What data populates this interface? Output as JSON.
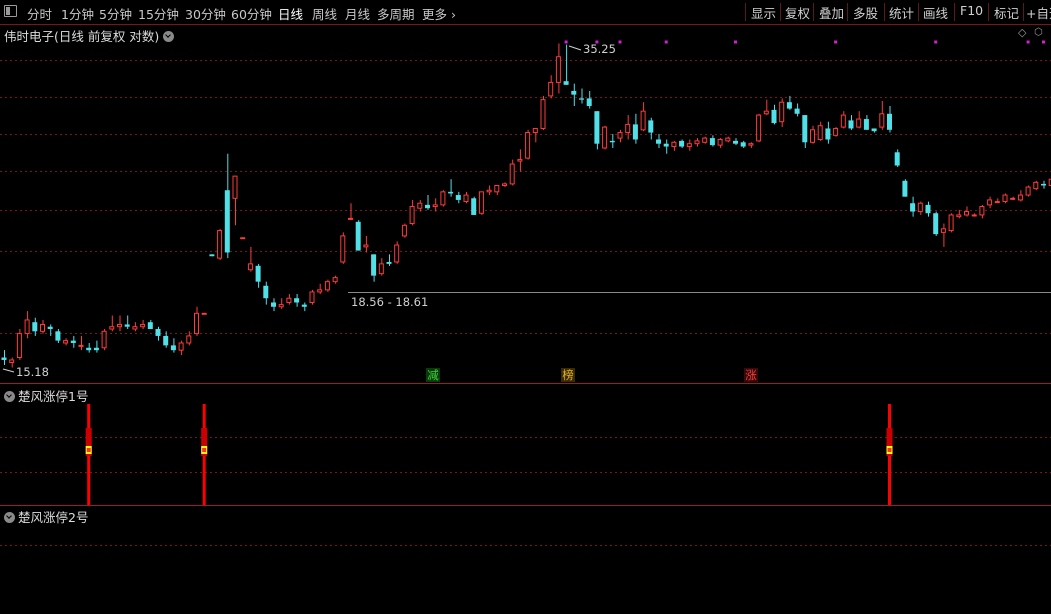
{
  "toolbar": {
    "periods": [
      "分时",
      "1分钟",
      "5分钟",
      "15分钟",
      "30分钟",
      "60分钟",
      "日线",
      "周线",
      "月线",
      "多周期",
      "更多"
    ],
    "selected_period": "日线",
    "right_tools": [
      "显示",
      "复权",
      "叠加",
      "多股",
      "统计",
      "画线",
      "F10",
      "标记",
      "+自选"
    ]
  },
  "main_chart": {
    "title": "伟时电子(日线 前复权 对数)",
    "high_label": "35.25",
    "low_label": "15.18",
    "range_label": "18.56 - 18.61",
    "event_tags": [
      {
        "text": "减",
        "color": "#20c020"
      },
      {
        "text": "榜",
        "color": "#d0a020"
      },
      {
        "text": "涨",
        "color": "#e03030"
      }
    ]
  },
  "indicator_panels": [
    {
      "title": "楚风涨停1号"
    },
    {
      "title": "楚风涨停2号"
    }
  ],
  "colors": {
    "up": "#ff3b3b",
    "down": "#4fe0e8",
    "grid": "#7a1818",
    "border": "#9a2020",
    "signal": "#ff0000",
    "marker": "#d020d0"
  },
  "chart_data": {
    "type": "candlestick",
    "scale": "log",
    "grid": true,
    "candles": [
      [
        15.6,
        15.9,
        15.3,
        15.5
      ],
      [
        15.4,
        15.6,
        15.2,
        15.5
      ],
      [
        15.6,
        16.8,
        15.5,
        16.6
      ],
      [
        16.6,
        17.6,
        16.4,
        17.2
      ],
      [
        17.1,
        17.3,
        16.5,
        16.7
      ],
      [
        16.7,
        17.2,
        16.6,
        17.0
      ],
      [
        16.9,
        17.0,
        16.5,
        16.8
      ],
      [
        16.7,
        16.8,
        16.2,
        16.3
      ],
      [
        16.2,
        16.4,
        16.1,
        16.3
      ],
      [
        16.3,
        16.5,
        16.0,
        16.2
      ],
      [
        16.1,
        16.5,
        15.9,
        16.1
      ],
      [
        16.0,
        16.2,
        15.8,
        15.9
      ],
      [
        16.0,
        16.3,
        15.8,
        15.9
      ],
      [
        16.0,
        16.8,
        15.9,
        16.7
      ],
      [
        16.8,
        17.4,
        16.7,
        16.9
      ],
      [
        16.9,
        17.4,
        16.7,
        17.0
      ],
      [
        17.0,
        17.4,
        16.8,
        16.9
      ],
      [
        16.8,
        17.1,
        16.7,
        16.9
      ],
      [
        16.9,
        17.2,
        16.8,
        17.0
      ],
      [
        17.1,
        17.2,
        16.8,
        16.8
      ],
      [
        16.8,
        16.9,
        16.3,
        16.5
      ],
      [
        16.5,
        16.7,
        16.0,
        16.1
      ],
      [
        16.1,
        16.4,
        15.8,
        15.9
      ],
      [
        15.9,
        16.3,
        15.7,
        16.2
      ],
      [
        16.2,
        16.7,
        16.1,
        16.5
      ],
      [
        16.6,
        17.8,
        16.5,
        17.5
      ],
      [
        17.5,
        17.5,
        17.5,
        17.5
      ],
      [
        20.4,
        20.4,
        20.3,
        20.3
      ],
      [
        20.2,
        21.8,
        20.1,
        21.7
      ],
      [
        24.1,
        26.5,
        20.2,
        20.5
      ],
      [
        23.6,
        25.0,
        22.0,
        25.0
      ],
      [
        21.3,
        21.3,
        21.3,
        21.3
      ],
      [
        19.6,
        20.8,
        19.5,
        19.9
      ],
      [
        19.8,
        19.9,
        18.7,
        19.0
      ],
      [
        18.8,
        19.0,
        17.9,
        18.2
      ],
      [
        18.0,
        18.2,
        17.6,
        17.8
      ],
      [
        17.8,
        18.2,
        17.7,
        17.9
      ],
      [
        18.0,
        18.4,
        17.9,
        18.2
      ],
      [
        18.2,
        18.4,
        17.8,
        18.0
      ],
      [
        17.9,
        18.0,
        17.6,
        17.8
      ],
      [
        18.0,
        18.6,
        17.9,
        18.5
      ],
      [
        18.5,
        18.9,
        18.4,
        18.6
      ],
      [
        18.6,
        19.1,
        18.5,
        19.0
      ],
      [
        19.0,
        19.3,
        18.9,
        19.2
      ],
      [
        20.0,
        21.6,
        19.9,
        21.4
      ],
      [
        22.4,
        23.3,
        22.3,
        22.4
      ],
      [
        22.2,
        22.3,
        20.6,
        20.6
      ],
      [
        20.8,
        21.4,
        20.5,
        20.9
      ],
      [
        20.4,
        20.4,
        19.0,
        19.3
      ],
      [
        19.4,
        20.2,
        19.3,
        19.9
      ],
      [
        20.0,
        20.4,
        19.8,
        19.9
      ],
      [
        20.0,
        21.1,
        19.9,
        20.9
      ],
      [
        21.4,
        22.1,
        21.3,
        22.0
      ],
      [
        22.1,
        23.5,
        22.0,
        23.1
      ],
      [
        23.0,
        23.5,
        22.8,
        23.3
      ],
      [
        23.2,
        23.8,
        22.9,
        23.0
      ],
      [
        23.1,
        23.6,
        22.8,
        23.2
      ],
      [
        23.2,
        24.1,
        23.1,
        24.0
      ],
      [
        24.0,
        24.8,
        23.7,
        23.9
      ],
      [
        23.8,
        24.0,
        23.3,
        23.5
      ],
      [
        23.4,
        24.0,
        23.3,
        23.8
      ],
      [
        23.6,
        23.7,
        22.6,
        22.6
      ],
      [
        22.7,
        24.0,
        22.6,
        24.0
      ],
      [
        24.0,
        24.4,
        23.8,
        24.1
      ],
      [
        24.0,
        24.4,
        23.8,
        24.4
      ],
      [
        24.4,
        24.6,
        24.3,
        24.5
      ],
      [
        24.5,
        26.1,
        24.4,
        25.8
      ],
      [
        26.0,
        26.8,
        25.3,
        26.1
      ],
      [
        26.2,
        28.2,
        26.1,
        28.0
      ],
      [
        28.0,
        28.3,
        27.3,
        28.3
      ],
      [
        28.3,
        30.8,
        28.2,
        30.5
      ],
      [
        30.8,
        32.5,
        30.6,
        31.9
      ],
      [
        31.9,
        35.3,
        31.0,
        34.1
      ],
      [
        32.0,
        35.2,
        31.7,
        31.7
      ],
      [
        31.2,
        31.8,
        30.0,
        30.9
      ],
      [
        30.6,
        31.4,
        30.2,
        30.5
      ],
      [
        30.6,
        31.2,
        29.8,
        30.0
      ],
      [
        29.6,
        29.6,
        26.8,
        27.2
      ],
      [
        26.9,
        28.5,
        26.8,
        28.4
      ],
      [
        27.4,
        27.9,
        26.9,
        27.3
      ],
      [
        27.6,
        28.2,
        27.3,
        28.0
      ],
      [
        28.0,
        29.3,
        27.5,
        28.6
      ],
      [
        28.6,
        29.4,
        27.2,
        27.5
      ],
      [
        28.2,
        30.3,
        28.1,
        29.6
      ],
      [
        28.9,
        29.1,
        27.5,
        28.0
      ],
      [
        27.5,
        27.9,
        26.9,
        27.2
      ],
      [
        27.2,
        27.5,
        26.5,
        27.0
      ],
      [
        27.0,
        27.4,
        26.7,
        27.3
      ],
      [
        27.4,
        27.5,
        26.9,
        27.0
      ],
      [
        27.0,
        27.5,
        26.7,
        27.2
      ],
      [
        27.2,
        27.6,
        27.0,
        27.4
      ],
      [
        27.3,
        27.7,
        27.2,
        27.6
      ],
      [
        27.6,
        27.8,
        27.0,
        27.1
      ],
      [
        27.1,
        27.6,
        26.9,
        27.5
      ],
      [
        27.4,
        27.7,
        27.3,
        27.6
      ],
      [
        27.4,
        27.6,
        27.1,
        27.2
      ],
      [
        27.3,
        27.4,
        26.9,
        27.0
      ],
      [
        27.1,
        27.3,
        26.9,
        27.2
      ],
      [
        27.4,
        29.4,
        27.3,
        29.3
      ],
      [
        29.4,
        30.5,
        29.3,
        29.6
      ],
      [
        29.7,
        30.1,
        28.6,
        28.7
      ],
      [
        28.8,
        30.6,
        28.4,
        30.3
      ],
      [
        30.3,
        30.8,
        29.7,
        29.8
      ],
      [
        29.8,
        30.2,
        29.2,
        29.4
      ],
      [
        29.3,
        29.3,
        26.9,
        27.3
      ],
      [
        27.3,
        28.5,
        27.2,
        28.2
      ],
      [
        27.5,
        28.8,
        27.4,
        28.5
      ],
      [
        28.3,
        28.8,
        27.2,
        27.5
      ],
      [
        27.8,
        28.4,
        27.7,
        28.3
      ],
      [
        28.4,
        29.6,
        28.3,
        29.3
      ],
      [
        28.9,
        29.3,
        28.2,
        28.3
      ],
      [
        28.4,
        29.6,
        28.3,
        29.0
      ],
      [
        29.0,
        29.3,
        28.2,
        28.2
      ],
      [
        28.3,
        28.3,
        28.0,
        28.1
      ],
      [
        28.4,
        30.4,
        28.2,
        29.4
      ],
      [
        29.4,
        30.0,
        28.0,
        28.2
      ],
      [
        26.6,
        26.8,
        25.6,
        25.7
      ],
      [
        24.7,
        24.8,
        23.7,
        23.7
      ],
      [
        23.3,
        23.7,
        22.5,
        22.8
      ],
      [
        22.8,
        23.4,
        22.6,
        23.3
      ],
      [
        23.2,
        23.4,
        22.5,
        22.7
      ],
      [
        22.7,
        22.8,
        21.4,
        21.5
      ],
      [
        21.6,
        22.1,
        20.8,
        21.8
      ],
      [
        21.7,
        22.7,
        21.6,
        22.6
      ],
      [
        22.5,
        22.9,
        22.4,
        22.6
      ],
      [
        22.6,
        23.1,
        22.5,
        22.8
      ],
      [
        22.6,
        22.7,
        22.5,
        22.6
      ],
      [
        22.6,
        23.2,
        22.4,
        23.1
      ],
      [
        23.2,
        23.7,
        23.0,
        23.5
      ],
      [
        23.4,
        23.6,
        23.3,
        23.4
      ],
      [
        23.4,
        23.9,
        23.3,
        23.8
      ],
      [
        23.6,
        23.7,
        23.5,
        23.6
      ],
      [
        23.5,
        24.1,
        23.4,
        23.8
      ],
      [
        23.8,
        24.4,
        23.7,
        24.3
      ],
      [
        24.2,
        24.7,
        24.1,
        24.6
      ],
      [
        24.5,
        24.7,
        24.2,
        24.4
      ],
      [
        24.4,
        24.9,
        24.3,
        24.8
      ],
      [
        24.7,
        25.3,
        24.6,
        25.2
      ],
      [
        25.2,
        25.5,
        24.9,
        25.0
      ],
      [
        25.0,
        25.9,
        24.9,
        25.8
      ],
      [
        25.7,
        26.2,
        25.6,
        26.1
      ],
      [
        26.1,
        27.4,
        26.0,
        27.2
      ],
      [
        27.3,
        28.2,
        26.9,
        27.4
      ],
      [
        27.5,
        27.8,
        26.8,
        27.5
      ]
    ],
    "signals_panel_1": [
      11,
      26,
      115
    ]
  }
}
